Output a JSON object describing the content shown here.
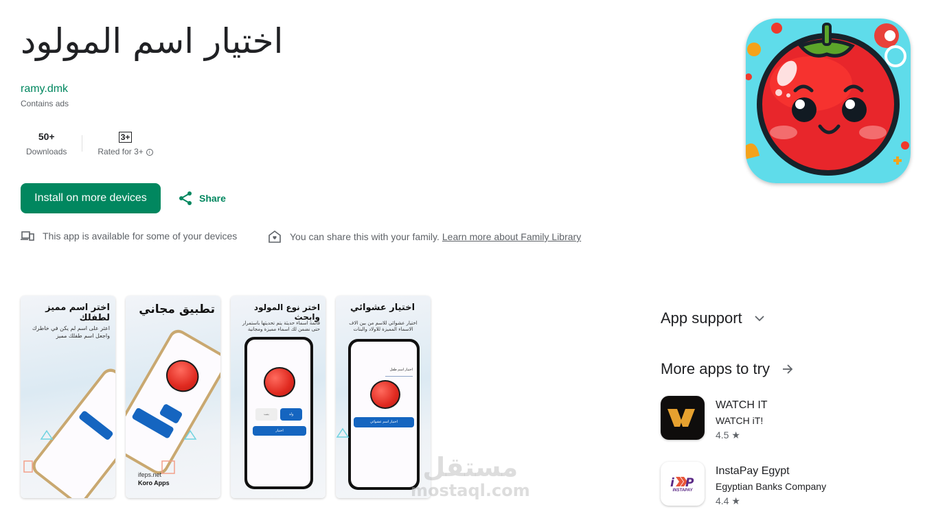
{
  "app": {
    "title": "اختيار اسم المولود",
    "developer": "ramy.dmk",
    "contains_ads": "Contains ads",
    "icon": "tomato-app-icon"
  },
  "stats": {
    "downloads_value": "50+",
    "downloads_label": "Downloads",
    "rating_badge": "3+",
    "rating_label": "Rated for 3+",
    "info_icon": "ⓘ"
  },
  "actions": {
    "install_label": "Install on more devices",
    "share_label": "Share"
  },
  "availability": {
    "devices_text": "This app is available for some of your devices",
    "family_text": "You can share this with your family.",
    "family_link": "Learn more about Family Library"
  },
  "screenshots": [
    {
      "heading": "اختر اسم مميز لطفلك",
      "subtitle": "اعثر على اسم لم يكن في خاطرك واجعل اسم طفلك مميز"
    },
    {
      "heading": "تطبيق مجاني",
      "footer_1": "ifeps.net",
      "footer_2": "Koro Apps"
    },
    {
      "heading": "اختر نوع المولود وابحث",
      "subtitle": "قائمة اسماء حديثة يتم تحديثها باستمرار حتى نضمن لك اسماء مميزة ومجانية",
      "btn_boy": "ولد",
      "btn_girl": "بنت",
      "btn_choose": "اختيار"
    },
    {
      "heading": "اختيار عشوائي",
      "subtitle": "اختيار عشوائي للاسم من بين الاف الاسماء المميزة للاولاد والبنات",
      "field_label": "اختيار اسم طفل",
      "btn_random": "اختيار اسم عشوائي"
    }
  ],
  "sidebar": {
    "app_support": "App support",
    "more_apps": "More apps to try",
    "apps": [
      {
        "name": "WATCH IT",
        "developer": "WATCH iT!",
        "rating": "4.5",
        "star": "★"
      },
      {
        "name": "InstaPay Egypt",
        "developer": "Egyptian Banks Company",
        "rating": "4.4",
        "star": "★"
      }
    ]
  },
  "watermark": {
    "arabic": "مستقل",
    "latin": "mostaql.com"
  }
}
